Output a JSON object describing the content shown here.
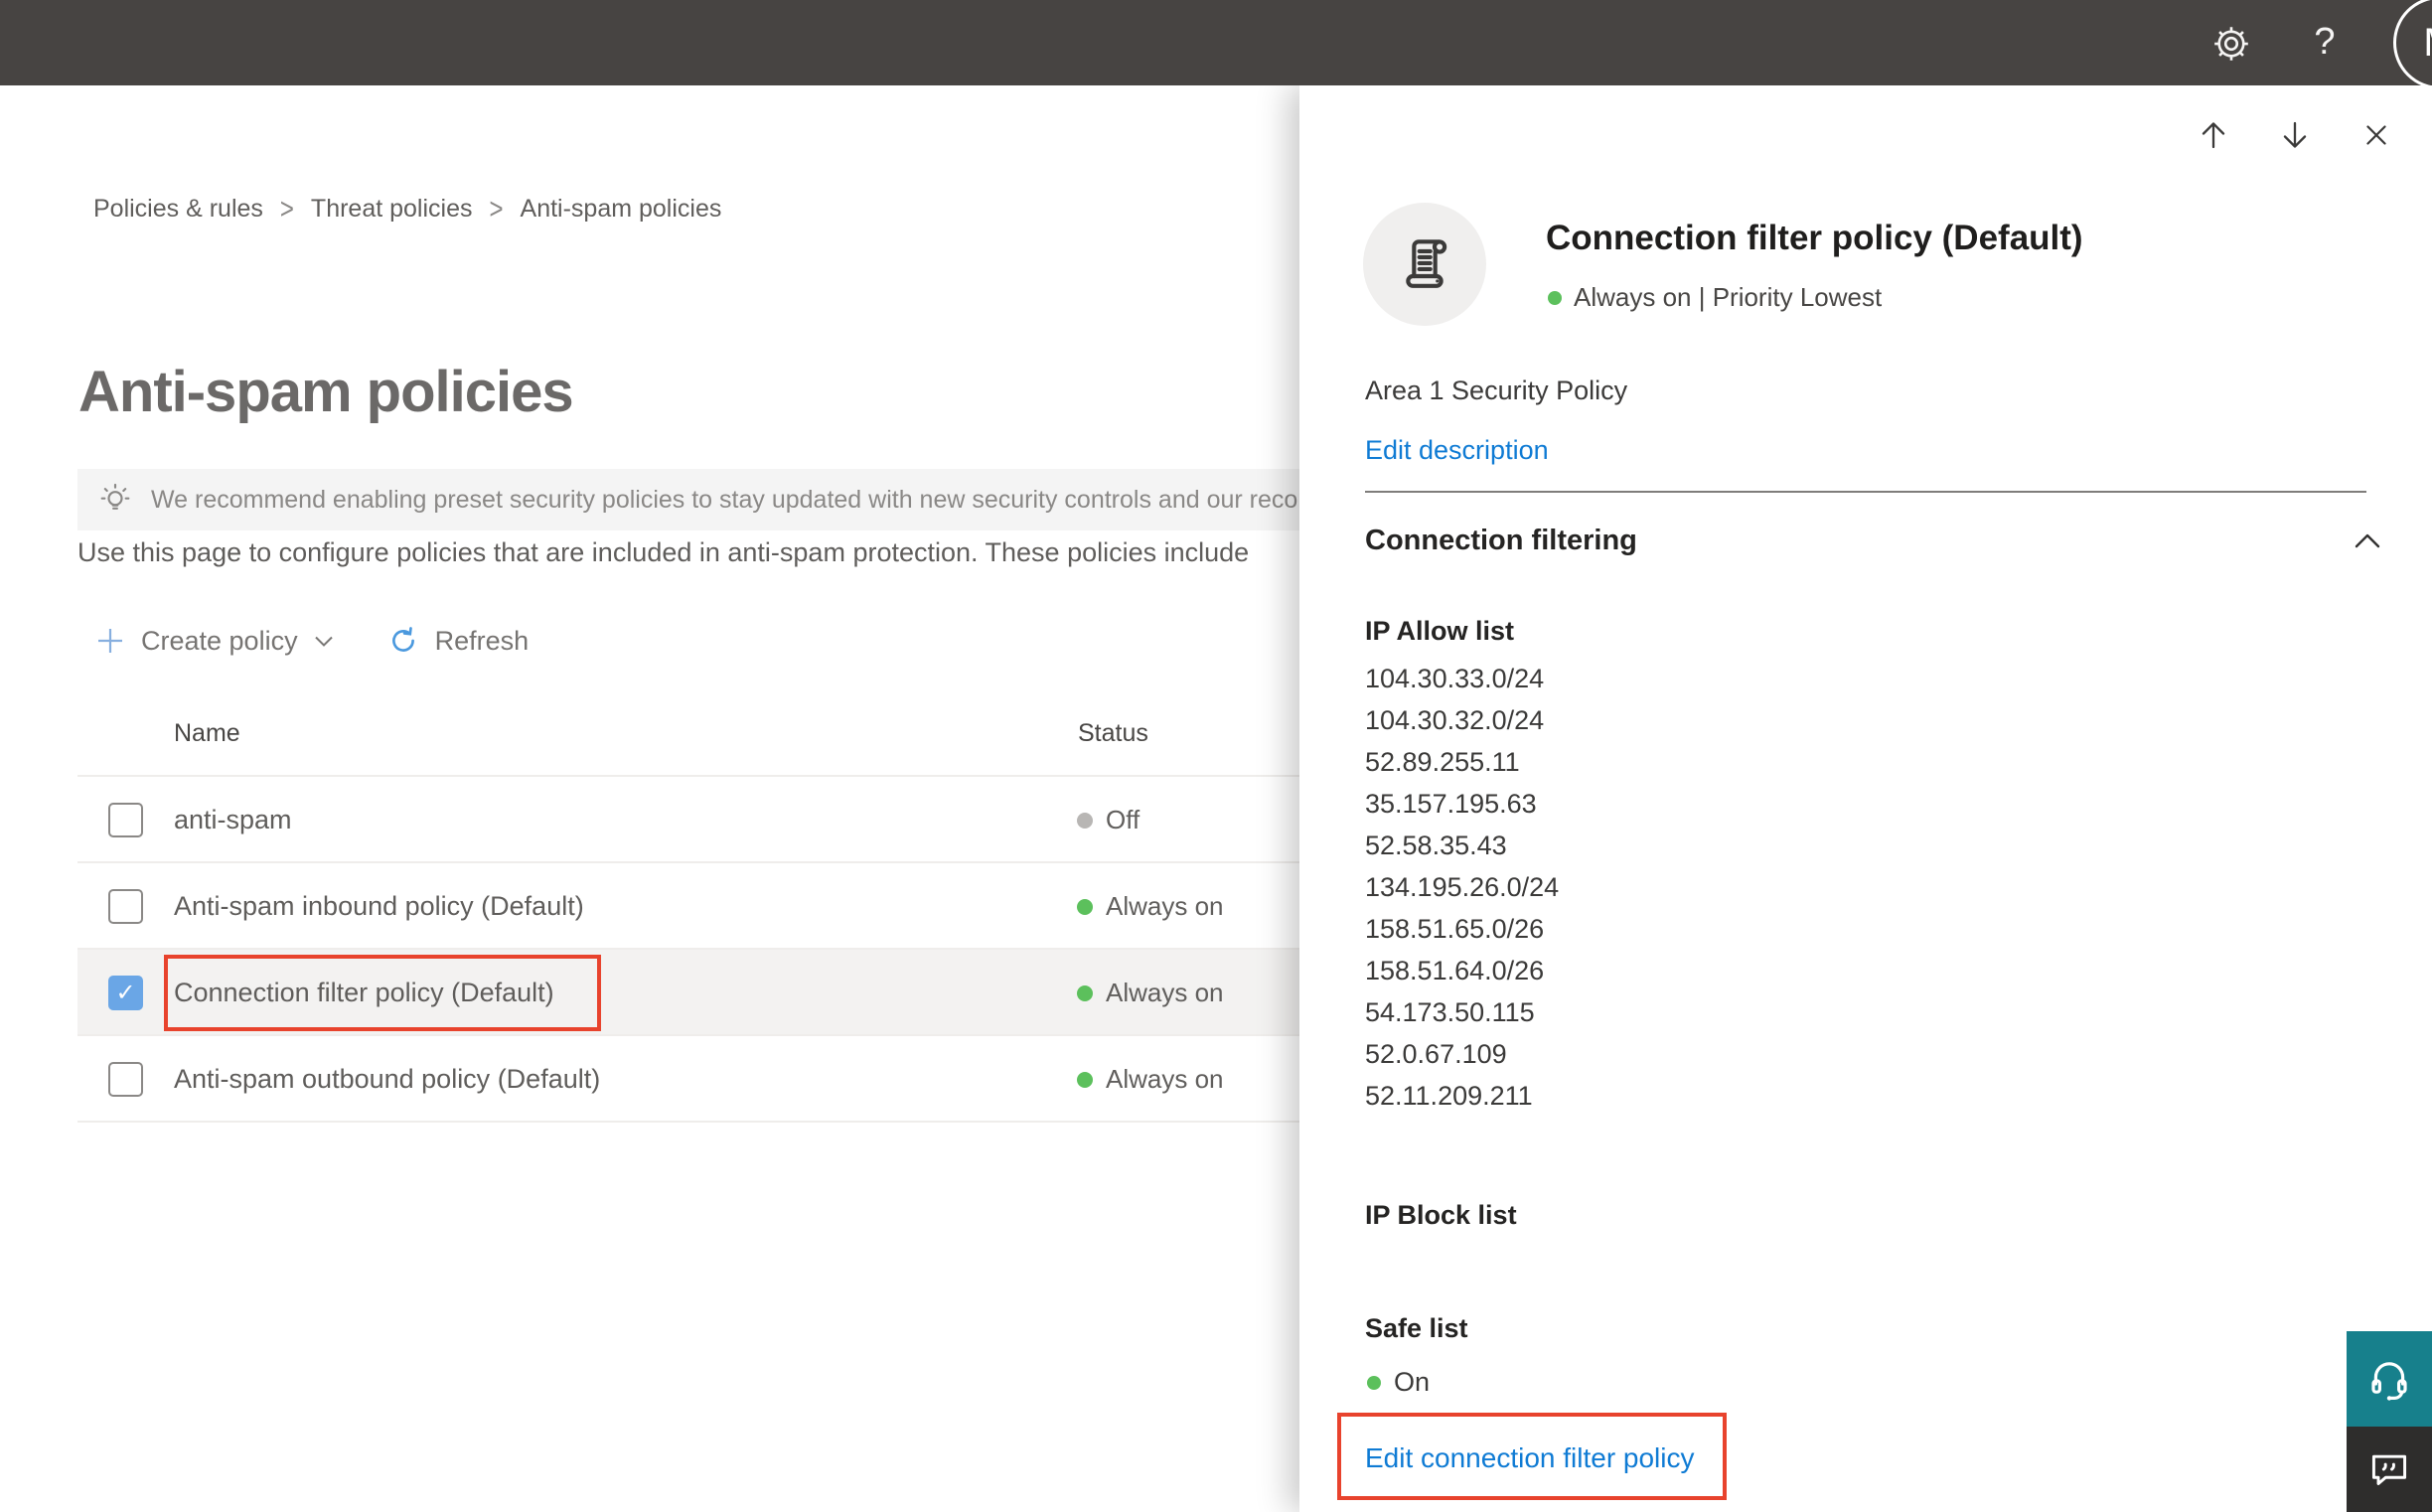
{
  "topbar": {
    "help_label": "?",
    "avatar_initial": "M"
  },
  "breadcrumb": {
    "separator": ">",
    "items": [
      "Policies & rules",
      "Threat policies",
      "Anti-spam policies"
    ]
  },
  "page": {
    "title": "Anti-spam policies",
    "banner_text": "We recommend enabling preset security policies to stay updated with new security controls and our recomme",
    "intro_text": "Use this page to configure policies that are included in anti-spam protection. These policies include",
    "toolbar": {
      "create_policy_label": "Create policy",
      "refresh_label": "Refresh"
    },
    "columns": {
      "name": "Name",
      "status": "Status"
    }
  },
  "table": {
    "rows": [
      {
        "name": "anti-spam",
        "status": "Off"
      },
      {
        "name": "Anti-spam inbound policy (Default)",
        "status": "Always on"
      },
      {
        "name": "Connection filter policy (Default)",
        "status": "Always on"
      },
      {
        "name": "Anti-spam outbound policy (Default)",
        "status": "Always on"
      }
    ]
  },
  "panel": {
    "title": "Connection filter policy (Default)",
    "status_line": "Always on | Priority Lowest",
    "description": "Area 1 Security Policy",
    "edit_description_label": "Edit description",
    "section_title": "Connection filtering",
    "ip_allow_label": "IP Allow list",
    "ip_allow_items": [
      "104.30.33.0/24",
      "104.30.32.0/24",
      "52.89.255.11",
      "35.157.195.63",
      "52.58.35.43",
      "134.195.26.0/24",
      "158.51.65.0/26",
      "158.51.64.0/26",
      "54.173.50.115",
      "52.0.67.109",
      "52.11.209.211"
    ],
    "ip_block_label": "IP Block list",
    "safe_list_label": "Safe list",
    "safe_list_status": "On",
    "edit_link_label": "Edit connection filter policy"
  },
  "icons": {
    "check": "✓"
  },
  "colors": {
    "topbar": "#474442",
    "accent_blue": "#0f7bd4",
    "annotation_red": "#e8432d",
    "status_green": "#5cc05c",
    "status_gray": "#b8b6b4",
    "checkbox_checked_blue": "#6aa6e6",
    "selected_row": "#f3f2f1",
    "support_teal": "#17808c",
    "feedback_dark": "#2e2d2c"
  }
}
